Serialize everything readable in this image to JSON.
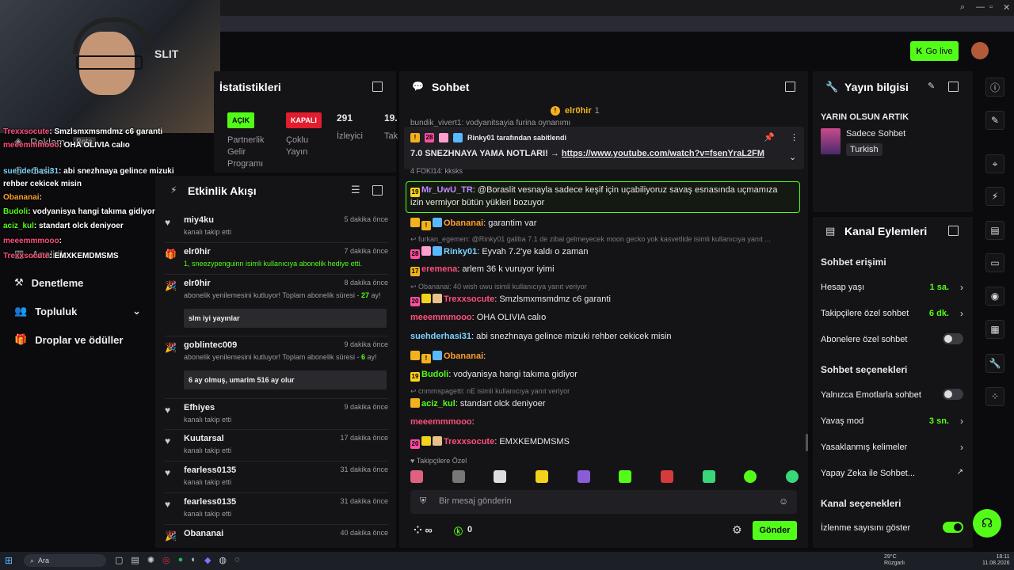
{
  "header": {
    "go_live": "Go live"
  },
  "stats": {
    "title": "İstatistikleri",
    "on_tag": "AÇIK",
    "off_tag": "KAPALI",
    "partner": "Partnerlik Gelir Programı",
    "multi": "Çoklu Yayın",
    "viewers_count": "291",
    "viewers_label": "İzleyici",
    "cut_value": "19.",
    "cut_label": "Tak"
  },
  "sidebar": {
    "reklam": "Reklam",
    "beta": "Beta",
    "gelir": "Gelir",
    "analitik": "Analitik",
    "denetleme": "Denetleme",
    "topluluk": "Topluluk",
    "droplar": "Droplar ve ödüller"
  },
  "overlay_chat": [
    {
      "user": "Trexxsocute",
      "text": ": Smzlsmxmsmdmz c6 garanti",
      "color": "#ff4f7b"
    },
    {
      "user": "meeemmmooo",
      "text": ": OHA OLIVIA calıo",
      "color": "#ff4f7b"
    },
    {
      "user": "suehderhasi31",
      "text": ": abi snezhnaya gelince mizuki",
      "color": "#7bd3ff"
    },
    {
      "user": "",
      "text": "rehber cekicek misin",
      "color": "#fff"
    },
    {
      "user": "Obananai",
      "text": ":",
      "color": "#ff9f2e"
    },
    {
      "user": "Budoli",
      "text": ": vodyanisya hangi takıma gidiyor",
      "color": "#53fc18"
    },
    {
      "user": "aciz_kul",
      "text": ": standart olck deniyoer",
      "color": "#53fc18"
    },
    {
      "user": "meeemmmooo",
      "text": ":",
      "color": "#ff4f7b"
    },
    {
      "user": "Trexxsocute",
      "text": ": EMXKEMDMSMS",
      "color": "#ff4f7b"
    }
  ],
  "activity": {
    "title": "Etkinlik Akışı",
    "items": [
      {
        "name": "miy4ku",
        "time": "5 dakika önce",
        "sub": "kanalı takip etti",
        "icon": "heart",
        "msg": ""
      },
      {
        "name": "elr0hir",
        "time": "7 dakika önce",
        "sub": "1, sneezypenguinn isimli kullanıcıya abonelik hediye etti.",
        "icon": "gift",
        "msg": ""
      },
      {
        "name": "elr0hir",
        "time": "8 dakika önce",
        "sub": "abonelik yenilemesini kutluyor! Toplam abonelik süresi -",
        "sub2": "27",
        "sub3": "ay!",
        "icon": "party",
        "msg": "slm iyi yayınlar"
      },
      {
        "name": "goblintec009",
        "time": "9 dakika önce",
        "sub": "abonelik yenilemesini kutluyor! Toplam abonelik süresi -",
        "sub2": "6",
        "sub3": "ay!",
        "icon": "party",
        "msg": "6 ay olmuş, umarim 516 ay olur"
      },
      {
        "name": "Efhiyes",
        "time": "9 dakika önce",
        "sub": "kanalı takip etti",
        "icon": "heart",
        "msg": ""
      },
      {
        "name": "Kuutarsal",
        "time": "17 dakika önce",
        "sub": "kanalı takip etti",
        "icon": "heart",
        "msg": ""
      },
      {
        "name": "fearless0135",
        "time": "31 dakika önce",
        "sub": "kanalı takip etti",
        "icon": "heart",
        "msg": ""
      },
      {
        "name": "fearless0135",
        "time": "31 dakika önce",
        "sub": "kanalı takip etti",
        "icon": "heart",
        "msg": ""
      },
      {
        "name": "Obananai",
        "time": "40 dakika önce",
        "sub": "",
        "icon": "party",
        "msg": ""
      }
    ]
  },
  "chat": {
    "title": "Sohbet",
    "top_user": "elr0hir",
    "top_count": "1",
    "pinned_by": "Rinky01 tarafından sabitlendi",
    "pinned_text": "7.0 SNEZHNAYA YAMA NOTLARI! → ",
    "pinned_link": "https://www.youtube.com/watch?v=fsenYraL2FM",
    "hidden_top": "bundik_vivert1: vodyanitsayia furina oynanımı",
    "hidden_top2": "4 FOKI14: kksks",
    "highlight_badge": "19",
    "highlight_user": "Mr_UwU_TR",
    "highlight_text": ": @Boraslit vesnayla sadece keşif için uçabiliyoruz savaş esnasında uçmamıza",
    "highlight_text2": "izin vermiyor bütün yükleri bozuyor",
    "lines": [
      {
        "type": "msg",
        "user": "Obananai",
        "color": "#ff9f2e",
        "text": ": garantim var"
      },
      {
        "type": "reply",
        "text": "furkan_egemen: @Rinky01 galiba 7.1 de zibai gelmeyecek moon gecko yok kasvetlide isimli kullanıcıya yanıt ..."
      },
      {
        "type": "msg",
        "user": "Rinky01",
        "color": "#7bd3ff",
        "text": ": Eyvah 7.2'ye kaldı o zaman"
      },
      {
        "type": "msg",
        "user": "eremena",
        "color": "#ff4f7b",
        "text": ": arlem 36 k vuruyor iyimi"
      },
      {
        "type": "reply",
        "text": "Obananai: 40 wish uwu isimli kullanıcıya yanıt veriyor"
      },
      {
        "type": "msg",
        "user": "Trexxsocute",
        "color": "#ff4f7b",
        "text": ": Smzlsmxmsmdmz c6 garanti"
      },
      {
        "type": "msg",
        "user": "meeemmmooo",
        "color": "#ff4f7b",
        "text": ": OHA OLIVIA calıo"
      },
      {
        "type": "msg",
        "user": "suehderhasi31",
        "color": "#7bd3ff",
        "text": ": abi snezhnaya gelince mizuki rehber cekicek misin"
      },
      {
        "type": "msg",
        "user": "Obananai",
        "color": "#ff9f2e",
        "text": ":"
      },
      {
        "type": "msg",
        "user": "Budoli",
        "color": "#53fc18",
        "text": ": vodyanisya hangi takıma gidiyor"
      },
      {
        "type": "reply",
        "text": "cnmmspagetti: nE isimli kullanıcıya yanıt veriyor"
      },
      {
        "type": "msg",
        "user": "aciz_kul",
        "color": "#53fc18",
        "text": ": standart olck deniyoer"
      },
      {
        "type": "msg",
        "user": "meeemmmooo",
        "color": "#ff4f7b",
        "text": ":"
      },
      {
        "type": "msg",
        "user": "Trexxsocute",
        "color": "#ff4f7b",
        "text": ": EMXKEMDMSMS"
      }
    ],
    "followers_only": "Takipçilere Özel",
    "input_placeholder": "Bir mesaj gönderin",
    "infinity": "∞",
    "kick_points": "0",
    "send": "Gönder"
  },
  "stream_info": {
    "title": "Yayın bilgisi",
    "stream_title": "YARIN OLSUN ARTIK",
    "category": "Sadece Sohbet",
    "language": "Turkish"
  },
  "channel": {
    "title": "Kanal Eylemleri",
    "access_title": "Sohbet erişimi",
    "account_age": "Hesap yaşı",
    "account_age_val": "1 sa.",
    "followers_chat": "Takipçilere özel sohbet",
    "followers_chat_val": "6 dk.",
    "subs_chat": "Abonelere özel sohbet",
    "options_title": "Sohbet seçenekleri",
    "emote_only": "Yalnızca Emotlarla sohbet",
    "slow_mode": "Yavaş mod",
    "slow_mode_val": "3 sn.",
    "banned_words": "Yasaklanmış kelimeler",
    "ai_chat": "Yapay Zeka ile Sohbet...",
    "channel_opts": "Kanal seçenekleri",
    "show_views": "İzlenme sayısını göster"
  },
  "taskbar": {
    "search": "Ara",
    "temp": "29°C",
    "weather": "Rüzgarlı",
    "time": "18:11",
    "date": "11.08.2026"
  },
  "colors": {
    "accent": "#53fc18",
    "panel": "#141417",
    "bg": "#0b0b0d"
  }
}
